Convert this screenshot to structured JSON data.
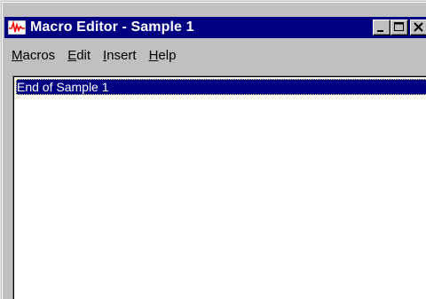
{
  "window": {
    "title": "Macro Editor - Sample 1",
    "app_icon": "waveform-icon",
    "title_color": "#000080",
    "caption_buttons": [
      "minimize",
      "maximize",
      "close"
    ]
  },
  "menubar": {
    "items": [
      {
        "label": "Macros",
        "mnemonic": "M"
      },
      {
        "label": "Edit",
        "mnemonic": "E"
      },
      {
        "label": "Insert",
        "mnemonic": "I"
      },
      {
        "label": "Help",
        "mnemonic": "H"
      }
    ]
  },
  "list": {
    "items": [
      {
        "text": "End of Sample 1",
        "selected": true
      }
    ]
  }
}
